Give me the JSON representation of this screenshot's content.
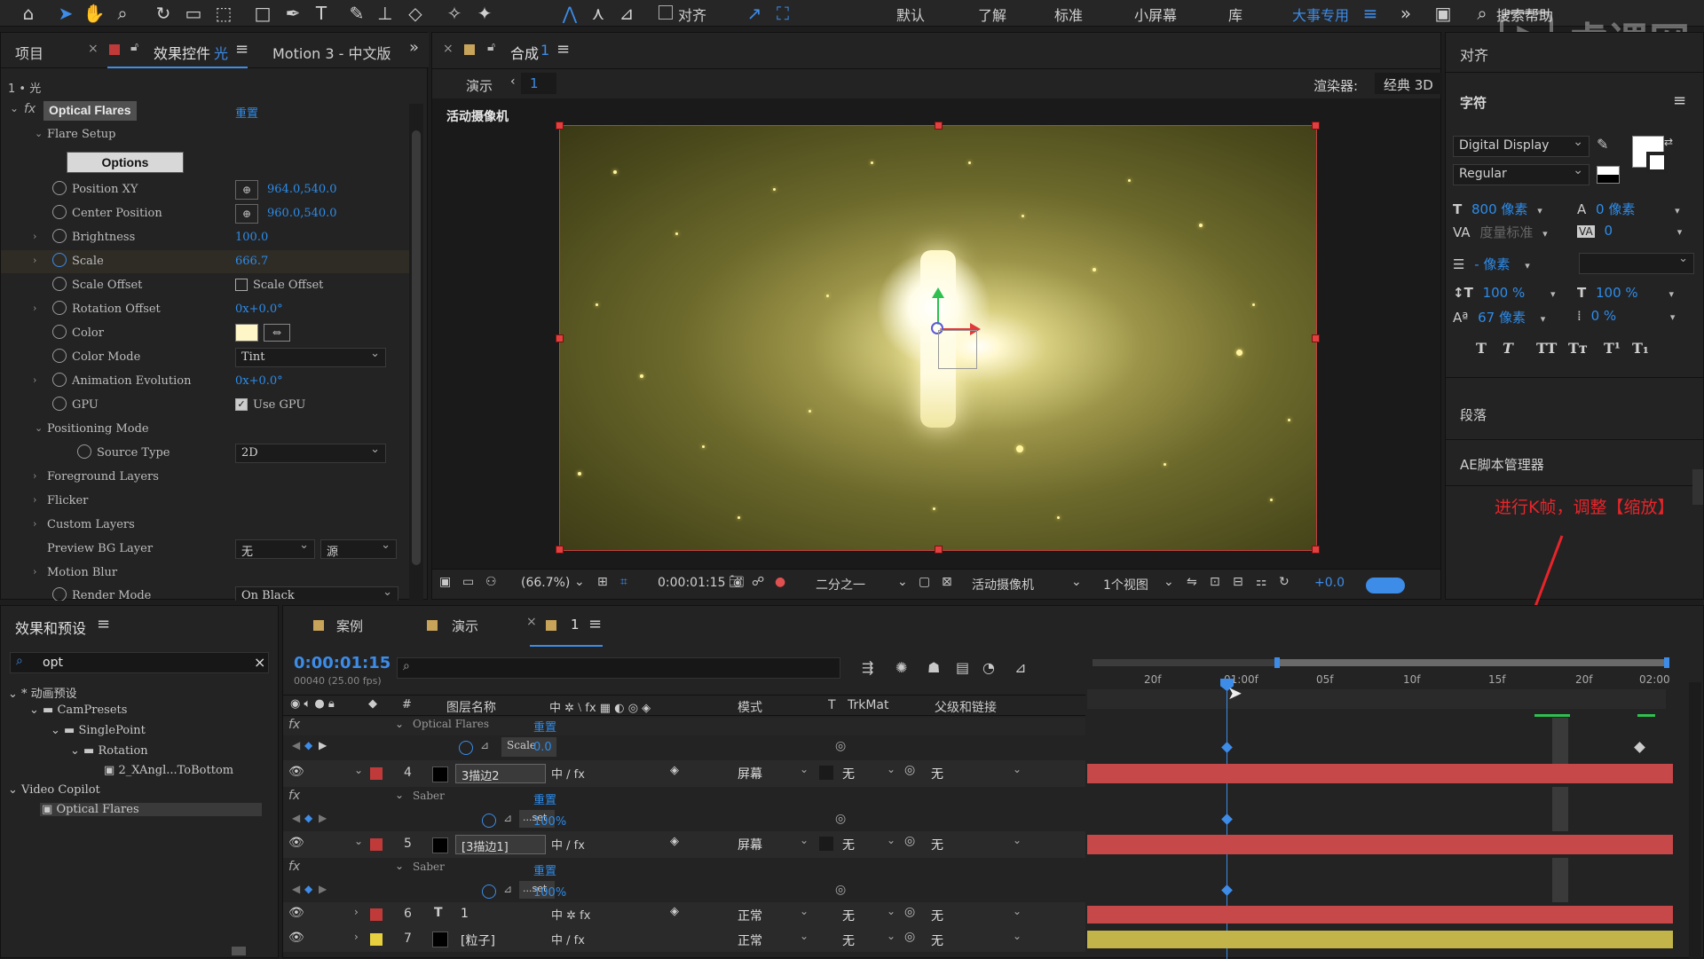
{
  "toolbar": {
    "align_label": "对齐",
    "workspaces": [
      "默认",
      "了解",
      "标准",
      "小屏幕",
      "库"
    ],
    "active_workspace": "大事专用",
    "search_help": "搜索帮助"
  },
  "effects_panel": {
    "tab_project": "项目",
    "tab_effect_controls": "效果控件",
    "tab_effect_layer": "光",
    "tab_motion": "Motion 3 - 中文版",
    "layer_path": "1 • 光",
    "effect_name": "Optical Flares",
    "reset_label": "重置",
    "flare_setup": "Flare Setup",
    "options_button": "Options",
    "props": [
      {
        "label": "Position XY",
        "value": "964.0,540.0"
      },
      {
        "label": "Center Position",
        "value": "960.0,540.0"
      },
      {
        "label": "Brightness",
        "value": "100.0"
      },
      {
        "label": "Scale",
        "value": "666.7"
      },
      {
        "label": "Scale Offset",
        "value": "Scale Offset"
      },
      {
        "label": "Rotation Offset",
        "value": "0x+0.0°"
      },
      {
        "label": "Color",
        "value": ""
      },
      {
        "label": "Color Mode",
        "value": "Tint"
      },
      {
        "label": "Animation Evolution",
        "value": "0x+0.0°"
      },
      {
        "label": "GPU",
        "value": "Use GPU"
      },
      {
        "label": "Positioning Mode",
        "value": ""
      },
      {
        "label": "Source Type",
        "value": "2D"
      },
      {
        "label": "Foreground Layers",
        "value": ""
      },
      {
        "label": "Flicker",
        "value": ""
      },
      {
        "label": "Custom Layers",
        "value": ""
      },
      {
        "label": "Preview BG Layer",
        "value": "无"
      },
      {
        "label": "Motion Blur",
        "value": ""
      },
      {
        "label": "Render Mode",
        "value": "On Black"
      }
    ],
    "preview_bg_source": "源"
  },
  "comp_panel": {
    "tab_label": "合成",
    "comp_number": "1",
    "breadcrumb_1": "演示",
    "breadcrumb_2": "1",
    "renderer_label": "渲染器:",
    "renderer_value": "经典 3D",
    "camera_label": "活动摄像机",
    "zoom": "(66.7%)",
    "timecode": "0:00:01:15",
    "resolution": "二分之一",
    "camera_select": "活动摄像机",
    "views": "1个视图",
    "exposure": "+0.0"
  },
  "character_panel": {
    "align_tab": "对齐",
    "title": "字符",
    "font_family": "Digital Display",
    "font_style": "Regular",
    "font_size": "800 像素",
    "leading": "0 像素",
    "kerning": "度量标准",
    "tracking": "0",
    "stroke_width": "- 像素",
    "vscale": "100 %",
    "hscale": "100 %",
    "baseline": "67 像素",
    "tsume": "0 %",
    "styles": [
      "T",
      "T",
      "TT",
      "Tт",
      "T¹",
      "T₁"
    ],
    "paragraph": "段落",
    "script_manager": "AE脚本管理器",
    "fill_color": "#ffffff",
    "stroke_color": "#000000"
  },
  "annotation": "进行K帧，调整【缩放】",
  "effects_presets": {
    "title": "效果和预设",
    "search_value": "opt",
    "tree": [
      "* 动画预设",
      "CamPresets",
      "SinglePoint",
      "Rotation",
      "2_XAngl...ToBottom",
      "Video Copilot",
      "Optical Flares"
    ]
  },
  "timeline": {
    "tabs": [
      "案例",
      "演示",
      "1"
    ],
    "timecode": "0:00:01:15",
    "frame_info": "00040 (25.00 fps)",
    "col_layer_name": "图层名称",
    "col_mode": "模式",
    "col_t": "T",
    "col_trkmat": "TrkMat",
    "col_parent": "父级和链接",
    "ruler": [
      "20f",
      "01:00f",
      "05f",
      "10f",
      "15f",
      "20f",
      "02:00"
    ],
    "rows": [
      {
        "type": "effect",
        "name": "Optical Flares",
        "value": "重置"
      },
      {
        "type": "prop",
        "name": "Scale",
        "value": "0.0"
      },
      {
        "type": "layer",
        "num": "4",
        "name": "3描边2",
        "mode": "屏幕",
        "trkmat": "无",
        "parent": "无",
        "color": "#c03a3a"
      },
      {
        "type": "effect",
        "name": "Saber",
        "value": "重置"
      },
      {
        "type": "prop",
        "name": "...set",
        "value": "100%"
      },
      {
        "type": "layer",
        "num": "5",
        "name": "[3描边1]",
        "mode": "屏幕",
        "trkmat": "无",
        "parent": "无",
        "color": "#c03a3a"
      },
      {
        "type": "effect",
        "name": "Saber",
        "value": "重置"
      },
      {
        "type": "prop",
        "name": "...set",
        "value": "100%"
      },
      {
        "type": "layer",
        "num": "6",
        "name": "1",
        "mode": "正常",
        "trkmat": "无",
        "parent": "无",
        "color": "#c03a3a"
      },
      {
        "type": "layer",
        "num": "7",
        "name": "[粒子]",
        "mode": "正常",
        "trkmat": "无",
        "parent": "无",
        "color": "#e6d040"
      }
    ]
  },
  "watermark": "虎课网"
}
